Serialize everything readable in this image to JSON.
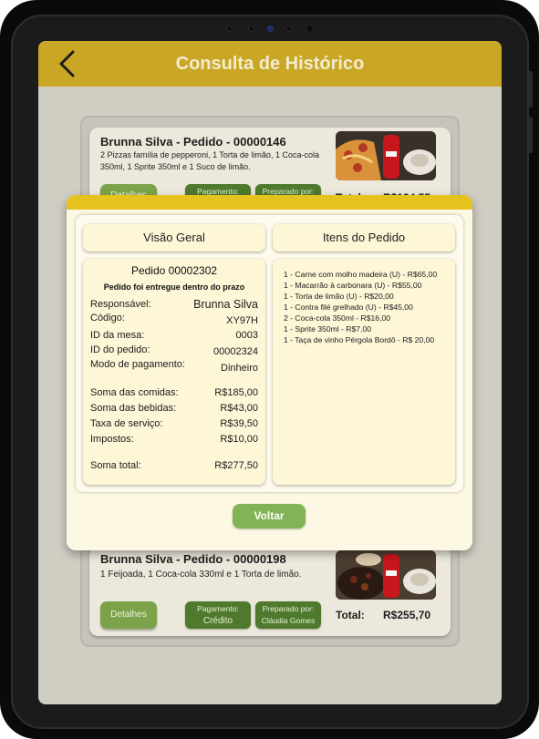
{
  "header": {
    "title": "Consulta de Histórico"
  },
  "orders": [
    {
      "title": "Brunna Silva -  Pedido - 00000146",
      "description": "2 Pizzas família de pepperoni, 1 Torta de limão, 1 Coca-cola 350ml, 1 Sprite 350ml e 1 Suco de limão.",
      "details_label": "Detalhes",
      "payment_label": "Pagamento:",
      "prepared_label": "Preparado por:",
      "total_label": "Total:",
      "total_value": "R$194,55"
    },
    {
      "title": "Brunna Silva - Pedido - 00000198",
      "description": "1 Feijoada, 1 Coca-cola 330ml e 1 Torta de limão.",
      "details_label": "Detalhes",
      "payment_label": "Pagamento:",
      "payment_value": "Crédito",
      "prepared_label": "Preparado por:",
      "prepared_value": "Cláudia Gomes",
      "total_label": "Total:",
      "total_value": "R$255,70"
    }
  ],
  "modal": {
    "tabs": {
      "overview": "Visão Geral",
      "items": "Itens do Pedido"
    },
    "overview": {
      "order_title": "Pedido 00002302",
      "status": "Pedido foi entregue dentro do prazo",
      "fields": [
        {
          "label": "Responsável:",
          "value": "Brunna Silva"
        },
        {
          "label": "Código:",
          "value": "XY97H"
        },
        {
          "label": "ID da mesa:",
          "value": "0003"
        },
        {
          "label": "ID do pedido:",
          "value": "00002324"
        },
        {
          "label": "Modo de pagamento:",
          "value": "Dinheiro"
        },
        {
          "label": "Soma das comidas:",
          "value": "R$185,00"
        },
        {
          "label": "Soma das bebidas:",
          "value": "R$43,00"
        },
        {
          "label": "Taxa de serviço:",
          "value": "R$39,50"
        },
        {
          "label": "Impostos:",
          "value": "R$10,00"
        },
        {
          "label": "Soma total:",
          "value": "R$277,50"
        }
      ]
    },
    "items": [
      "1 - Carne com molho madeira (U) - R$65,00",
      "1 - Macarrão à carbonara (U) - R$55,00",
      "1 - Torta de limão (U) - R$20,00",
      "1 - Contra filé grelhado (U) - R$45,00",
      "2 - Coca-cola 350ml - R$16,00",
      "1 - Sprite 350ml - R$7,00",
      "1 - Taça de vinho Pérgola Bordô - R$ 20,00"
    ],
    "back_label": "Voltar"
  },
  "colors": {
    "appbar": "#c9a624",
    "modal_accent": "#e6c21e",
    "button_green": "#82b357",
    "badge_green": "#4f7a2e"
  },
  "icons": {
    "back": "chevron-left-icon"
  }
}
